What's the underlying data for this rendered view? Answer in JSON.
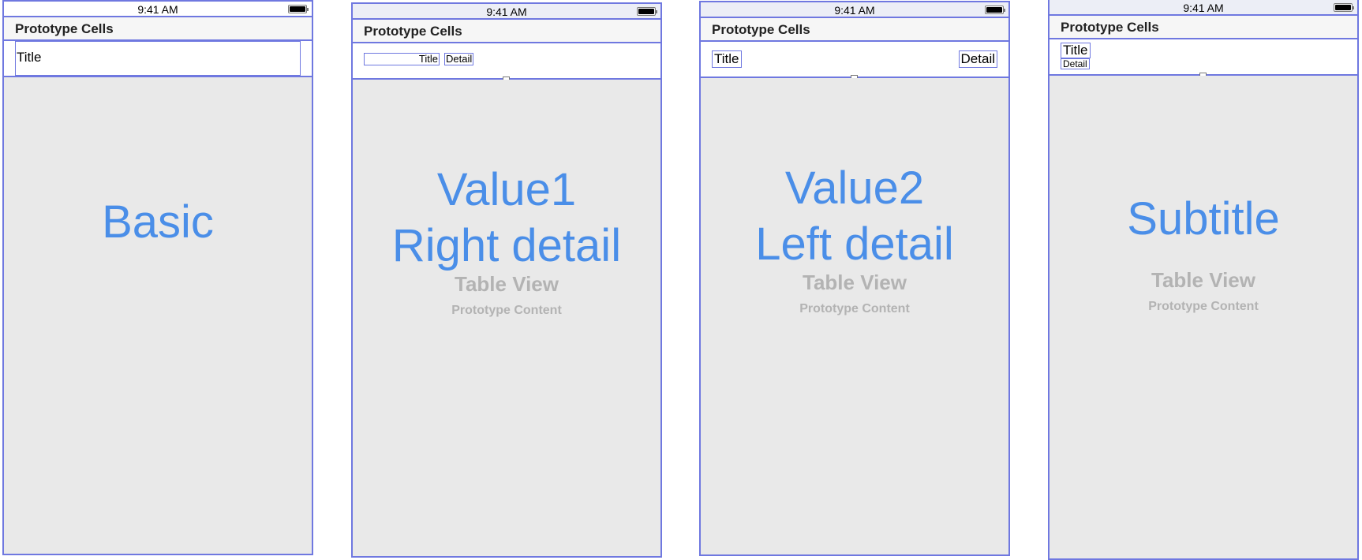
{
  "status_time": "9:41 AM",
  "section_title": "Prototype Cells",
  "table_view_title": "Table View",
  "table_view_subtitle": "Prototype Content",
  "phones": {
    "basic": {
      "style_title": "Basic",
      "cell_title": "Title"
    },
    "value1": {
      "style_title_line1": "Value1",
      "style_title_line2": "Right detail",
      "cell_title": "Title",
      "cell_detail": "Detail"
    },
    "value2": {
      "style_title_line1": "Value2",
      "style_title_line2": "Left detail",
      "cell_title": "Title",
      "cell_detail": "Detail"
    },
    "subtitle": {
      "style_title": "Subtitle",
      "cell_title": "Title",
      "cell_detail": "Detail"
    }
  },
  "colors": {
    "outline": "#6f78e0",
    "accent_blue": "#4a8ee8",
    "table_bg": "#e9e9e9",
    "placeholder_gray": "#b3b3b3"
  }
}
